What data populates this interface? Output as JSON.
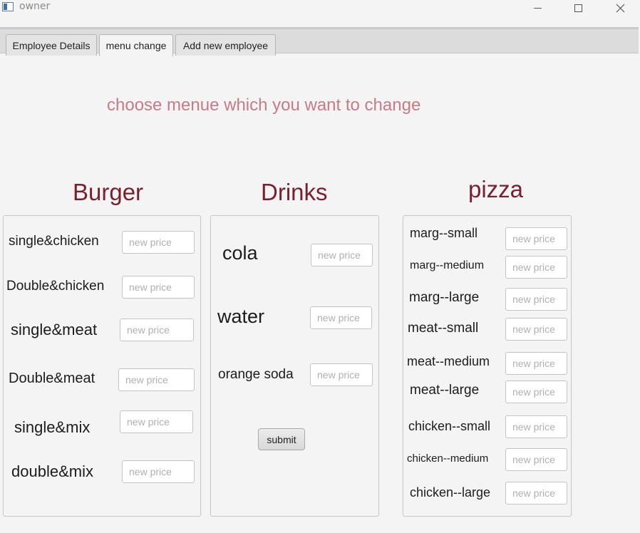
{
  "window": {
    "title": "owner",
    "icon": "app-window-icon",
    "controls": [
      "minimize-icon",
      "maximize-icon",
      "close-icon"
    ]
  },
  "tabs": [
    {
      "label": "Employee Details",
      "active": false
    },
    {
      "label": "menu change",
      "active": true
    },
    {
      "label": "Add new employee",
      "active": false
    }
  ],
  "headline": "choose menue which you want to change",
  "burger": {
    "title": "Burger",
    "items": [
      {
        "label": "single&chicken",
        "placeholder": "new price"
      },
      {
        "label": "Double&chicken",
        "placeholder": "new price"
      },
      {
        "label": "single&meat",
        "placeholder": "new price"
      },
      {
        "label": "Double&meat",
        "placeholder": "new price"
      },
      {
        "label": "single&mix",
        "placeholder": "new price"
      },
      {
        "label": "double&mix",
        "placeholder": "new price"
      }
    ]
  },
  "drinks": {
    "title": "Drinks",
    "items": [
      {
        "label": "cola",
        "placeholder": "new price"
      },
      {
        "label": "water",
        "placeholder": "new price"
      },
      {
        "label": "orange soda",
        "placeholder": "new price"
      }
    ],
    "submit_label": "submit"
  },
  "pizza": {
    "title": "pizza",
    "items": [
      {
        "label": "marg--small",
        "placeholder": "new price"
      },
      {
        "label": "marg--medium",
        "placeholder": "new price"
      },
      {
        "label": "marg--large",
        "placeholder": "new price"
      },
      {
        "label": "meat--small",
        "placeholder": "new price"
      },
      {
        "label": "meat--medium",
        "placeholder": "new price"
      },
      {
        "label": "meat--large",
        "placeholder": "new price"
      },
      {
        "label": "chicken--small",
        "placeholder": "new price"
      },
      {
        "label": "chicken--medium",
        "placeholder": "new price"
      },
      {
        "label": "chicken--large",
        "placeholder": "new price"
      }
    ]
  },
  "colors": {
    "headline": "#c77b84",
    "section_title": "#7a1f2e",
    "background": "#f4f4f4"
  }
}
